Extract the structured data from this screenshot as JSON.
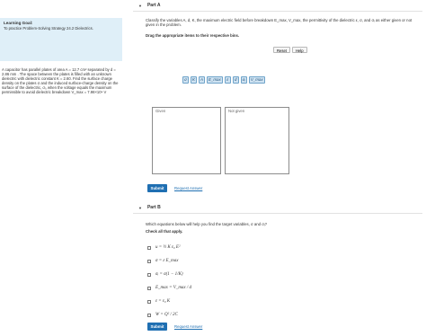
{
  "learning_goal": {
    "heading": "Learning Goal:",
    "text": "To practice Problem-Solving Strategy 24.2 Dielectrics."
  },
  "problem_text": "A capacitor has parallel plates of area A = 12.7 cm² separated by d = 2.86 mm . The space between the plates is filled with an unknown dielectric with dielectric constant K = 2.60. Find the surface charge density on the plates σ and the induced surface-charge density on the surface of the dielectric, σᵢ, when the voltage equals the maximum permissible to avoid dielectric breakdown V_max = 7.98×10⁴ V",
  "part_a": {
    "title": "Part A",
    "instruction": "Classify the variables A, d, K, the maximum electric field before breakdown E_max, V_max, the permittivity of the dielectric ε, σ, and σᵢ as either given or not given in the problem.",
    "drag_instruction": "Drag the appropriate items to their respective bins.",
    "reset_label": "Reset",
    "help_label": "Help",
    "chips": [
      "σ",
      "K",
      "A",
      "E_max",
      "ε",
      "d",
      "σᵢ",
      "V_max"
    ],
    "bins": [
      "Given",
      "Not given"
    ],
    "submit_label": "Submit",
    "request_label": "Request Answer"
  },
  "part_b": {
    "title": "Part B",
    "question": "Which equations below will help you find the target variables, σ and σᵢ?",
    "check_label": "Check all that apply.",
    "options": [
      "u = ½ K ε₀ E²",
      "σ = ε E_max",
      "σᵢ = σ(1 − 1/K)",
      "E_max = V_max / d",
      "ε = ε₀ K",
      "W = Q² / 2C"
    ],
    "submit_label": "Submit",
    "request_label": "Request Answer"
  }
}
